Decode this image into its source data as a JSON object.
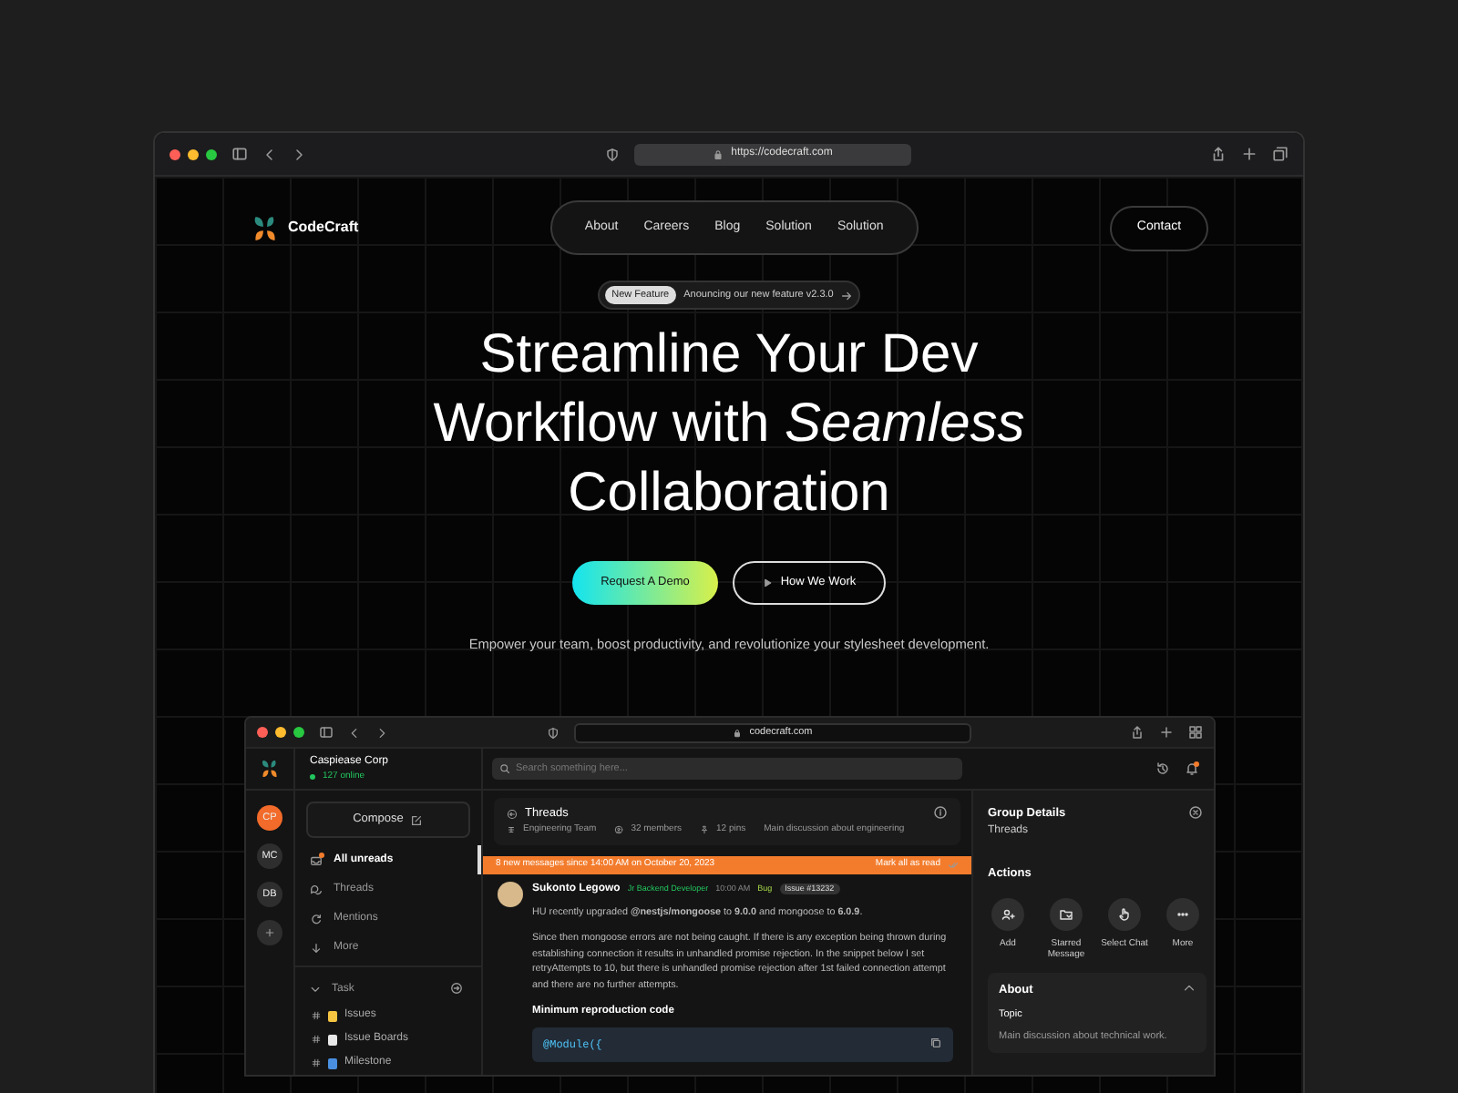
{
  "browser": {
    "url": "https://codecraft.com"
  },
  "brand": {
    "name": "CodeCraft"
  },
  "nav": [
    "About",
    "Careers",
    "Blog",
    "Solution",
    "Solution"
  ],
  "contact_button": "Contact",
  "announcement": {
    "tag": "New Feature",
    "text": "Anouncing our new feature v2.3.0"
  },
  "headline": [
    "Streamline Your Dev",
    "Workflow with *Seamless*",
    "Collaboration"
  ],
  "buttons": [
    {
      "label": "Request A Demo",
      "kind": "primary"
    },
    {
      "label": "How We Work",
      "kind": "play"
    }
  ],
  "subtitle": "Empower your team, boost productivity, and revolutionize your stylesheet development.",
  "app": {
    "url": "codecraft.com",
    "workspace": {
      "name": "Caspiease Corp",
      "status": "127 online"
    },
    "search": {
      "placeholder": "Search something here..."
    },
    "avatars": [
      {
        "initials": "CP",
        "selected": true
      },
      {
        "initials": "MC",
        "selected": false
      },
      {
        "initials": "DB",
        "selected": false
      }
    ],
    "compose": "Compose",
    "menu": [
      {
        "label": "All unreads",
        "kind": "inbox",
        "selected": true,
        "unread": true
      },
      {
        "label": "Threads",
        "kind": "threads",
        "selected": false,
        "unread": false
      },
      {
        "label": "Mentions",
        "kind": "mentions",
        "selected": false,
        "unread": false
      },
      {
        "label": "More",
        "kind": "more",
        "selected": false,
        "unread": false
      }
    ],
    "sections": [
      {
        "label": "Task",
        "expanded": true,
        "children": [
          {
            "label": "Issues",
            "kind": "memo"
          },
          {
            "label": "Issue Boards",
            "kind": "page"
          },
          {
            "label": "Milestone",
            "kind": "chart"
          }
        ]
      }
    ],
    "thread": {
      "title": "Threads",
      "team": "Engineering Team",
      "members": "32 members",
      "pins": "12 pins",
      "topic": "Main discussion about engineering"
    },
    "banner": {
      "text": "8 new messages since 14:00 AM on October 20, 2023",
      "action": "Mark all as read"
    },
    "message": {
      "author": "Sukonto Legowo",
      "role": "Jr Backend Developer",
      "time": "10:00 AM",
      "tag": "Bug",
      "issue": "Issue #13232",
      "body": [
        "HU recently upgraded **@nestjs/mongoose** to **9.0.0** and mongoose to **6.0.9**.",
        "Since then mongoose errors are not being caught. If there is any exception being thrown during establishing connection it results in unhandled promise rejection. In the snippet below I set retryAttempts to 10, but there is unhandled promise rejection after 1st failed connection attempt and there are no further attempts."
      ],
      "code_heading": "Minimum reproduction code",
      "code": [
        "@Module({"
      ]
    },
    "details": {
      "title": "Group Details",
      "subtitle": "Threads",
      "actions_heading": "Actions",
      "actions": [
        {
          "label": "Add",
          "kind": "add"
        },
        {
          "label": "Starred Message",
          "kind": "folder"
        },
        {
          "label": "Select Chat",
          "kind": "hand"
        },
        {
          "label": "More",
          "kind": "dots"
        }
      ],
      "about": {
        "title": "About",
        "expanded": true,
        "topic_label": "Topic",
        "topic": "Main discussion about technical work."
      }
    }
  }
}
